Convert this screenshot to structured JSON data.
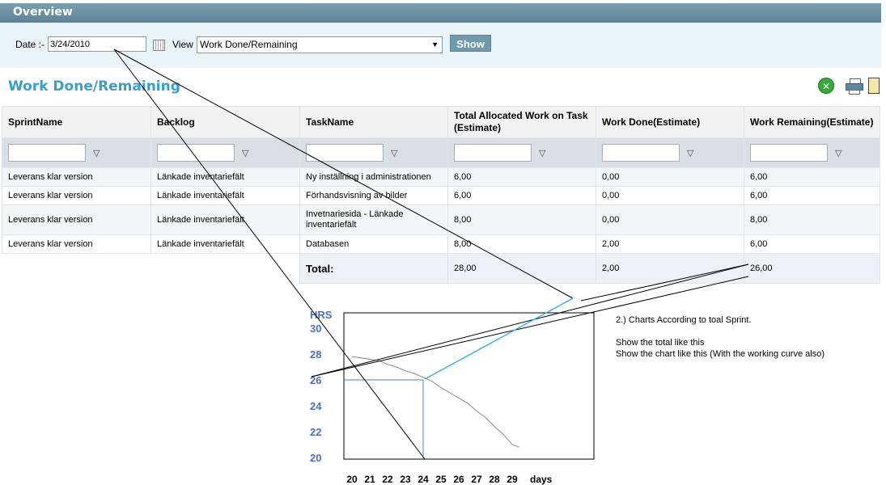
{
  "header": {
    "title": "Overview"
  },
  "filters": {
    "date_label": "Date :-",
    "date_value": "3/24/2010",
    "view_label": "View",
    "view_selected": "Work Done/Remaining",
    "show_label": "Show"
  },
  "section": {
    "title": "Work Done/Remaining"
  },
  "table": {
    "columns": [
      "SprintName",
      "Backlog",
      "TaskName",
      "Total Allocated Work on Task (Estimate)",
      "Work Done(Estimate)",
      "Work Remaining(Estimate)"
    ],
    "rows": [
      [
        "Leverans klar version",
        "Länkade inventariefält",
        "Ny inställning i administrationen",
        "6,00",
        "0,00",
        "6,00"
      ],
      [
        "Leverans klar version",
        "Länkade inventariefält",
        "Förhandsvisning av bilder",
        "6,00",
        "0,00",
        "6,00"
      ],
      [
        "Leverans klar version",
        "Länkade inventariefält",
        "Invetnariesida - Länkade inventariefält",
        "8,00",
        "0,00",
        "8,00"
      ],
      [
        "Leverans klar version",
        "Länkade inventariefält",
        "Databasen",
        "8,00",
        "2,00",
        "6,00"
      ]
    ],
    "total": {
      "label": "Total:",
      "allocated": "28,00",
      "done": "2,00",
      "remaining": "26,00"
    }
  },
  "notes": {
    "line1": "2.) Charts According to toal Sprint.",
    "line2": "Show the total like this",
    "line3": "Show the chart like this (With the working curve also)"
  },
  "chart_data": {
    "type": "line",
    "ylabel": "HRS",
    "xlabel": "days",
    "y_ticks": [
      "30",
      "28",
      "26",
      "24",
      "22",
      "20"
    ],
    "x_ticks": [
      "20",
      "21",
      "22",
      "23",
      "24",
      "25",
      "26",
      "27",
      "28",
      "29"
    ],
    "ylim": [
      20,
      30
    ],
    "marker": {
      "x": 24,
      "y": 26
    },
    "series": [
      {
        "x": [
          20,
          20.5,
          21,
          21.5,
          22,
          22.5,
          23,
          23.5,
          24,
          24.5,
          25,
          25.5,
          26,
          26.5,
          27,
          27.5,
          28,
          28.5,
          29,
          29.4
        ],
        "values": [
          27.8,
          27.7,
          27.6,
          27.5,
          27.2,
          27.0,
          26.7,
          26.5,
          26.2,
          25.9,
          25.4,
          25.0,
          24.6,
          24.2,
          23.6,
          23.1,
          22.4,
          21.8,
          21.0,
          20.8
        ]
      }
    ]
  },
  "colors": {
    "accent": "#35a1c9",
    "header": "#6a91a3",
    "axis_text": "#4a6fc7",
    "marker": "#4a7fd8",
    "cyan_line": "#2aaee6"
  },
  "icons": {
    "excel": "excel-icon",
    "print": "print-icon",
    "doc": "document-icon",
    "calendar": "calendar-icon",
    "filter": "filter-icon"
  }
}
